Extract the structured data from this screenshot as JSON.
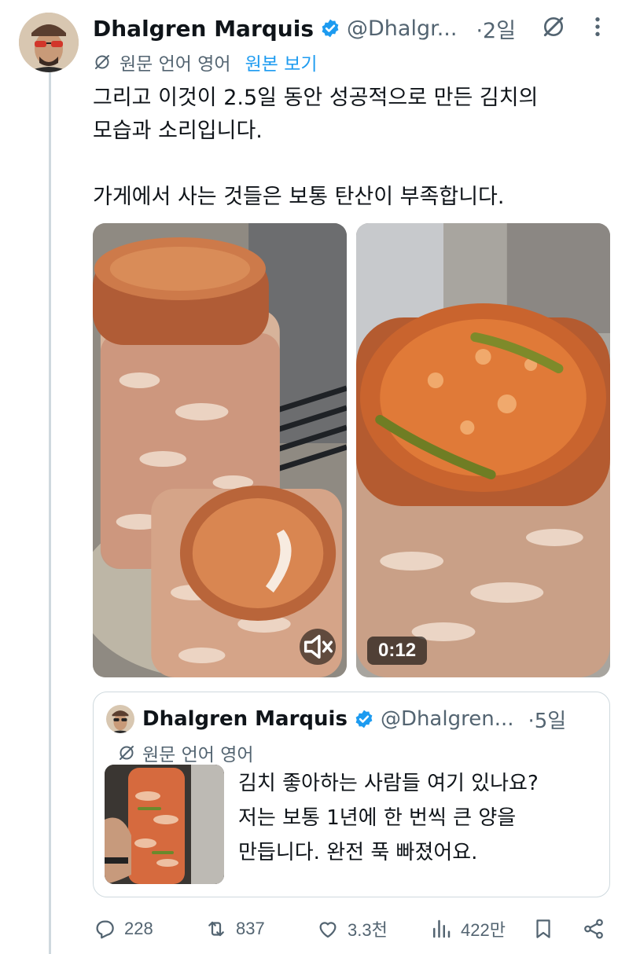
{
  "tweet": {
    "author_name": "Dhalgren Marquis",
    "handle": "@Dhalgr...",
    "timestamp": "·2일",
    "translation_note": "원문 언어 영어",
    "translation_link": "원본 보기",
    "body_lines": [
      "그리고 이것이 2.5일 동안 성공적으로 만든 김치의",
      "모습과 소리입니다.",
      "가게에서 사는 것들은 보통 탄산이 부족합니다."
    ],
    "media": {
      "video_duration": "0:12"
    }
  },
  "quoted_tweet": {
    "author_name": "Dhalgren Marquis",
    "handle": "@Dhalgren...",
    "timestamp": "·5일",
    "translation_note": "원문 언어 영어",
    "body_lines": [
      "김치 좋아하는 사람들 여기 있나요?",
      "저는 보통 1년에 한 번씩 큰 양을",
      "만듭니다. 완전 푹 빠졌어요."
    ]
  },
  "actions": {
    "replies": "228",
    "reposts": "837",
    "likes": "3.3천",
    "views": "422만"
  },
  "colors": {
    "accent": "#1d9bf0",
    "muted_text": "#536471",
    "border": "#cfd9de"
  }
}
